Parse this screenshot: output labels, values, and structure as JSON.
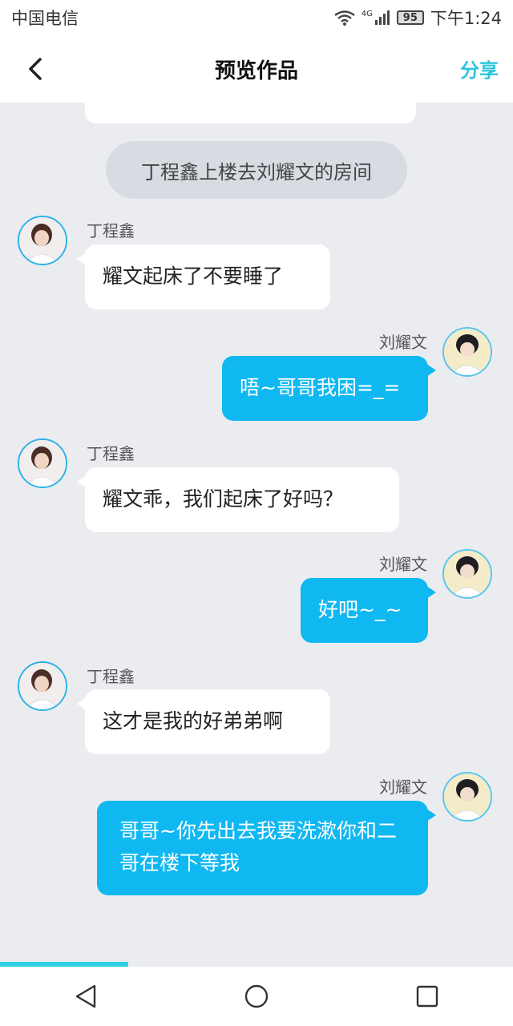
{
  "status_bar": {
    "carrier": "中国电信",
    "network": "4G",
    "battery": "95",
    "time": "下午1:24"
  },
  "header": {
    "title": "预览作品",
    "share_label": "分享"
  },
  "chat": {
    "narration": "丁程鑫上楼去刘耀文的房间",
    "messages": [
      {
        "sender": "丁程鑫",
        "side": "left",
        "text": "耀文起床了不要睡了"
      },
      {
        "sender": "刘耀文",
        "side": "right",
        "text": "唔~哥哥我困=_="
      },
      {
        "sender": "丁程鑫",
        "side": "left",
        "text": "耀文乖，我们起床了好吗？"
      },
      {
        "sender": "刘耀文",
        "side": "right",
        "text": "好吧~_~"
      },
      {
        "sender": "丁程鑫",
        "side": "left",
        "text": "这才是我的好弟弟啊"
      },
      {
        "sender": "刘耀文",
        "side": "right",
        "text": "哥哥~你先出去我要洗漱你和二哥在楼下等我"
      }
    ]
  },
  "playback": {
    "progress_fraction": 0.25
  },
  "colors": {
    "accent": "#2ec5dd",
    "right_bubble": "#10b8f2",
    "left_bubble": "#ffffff",
    "background": "#eaecf0"
  }
}
